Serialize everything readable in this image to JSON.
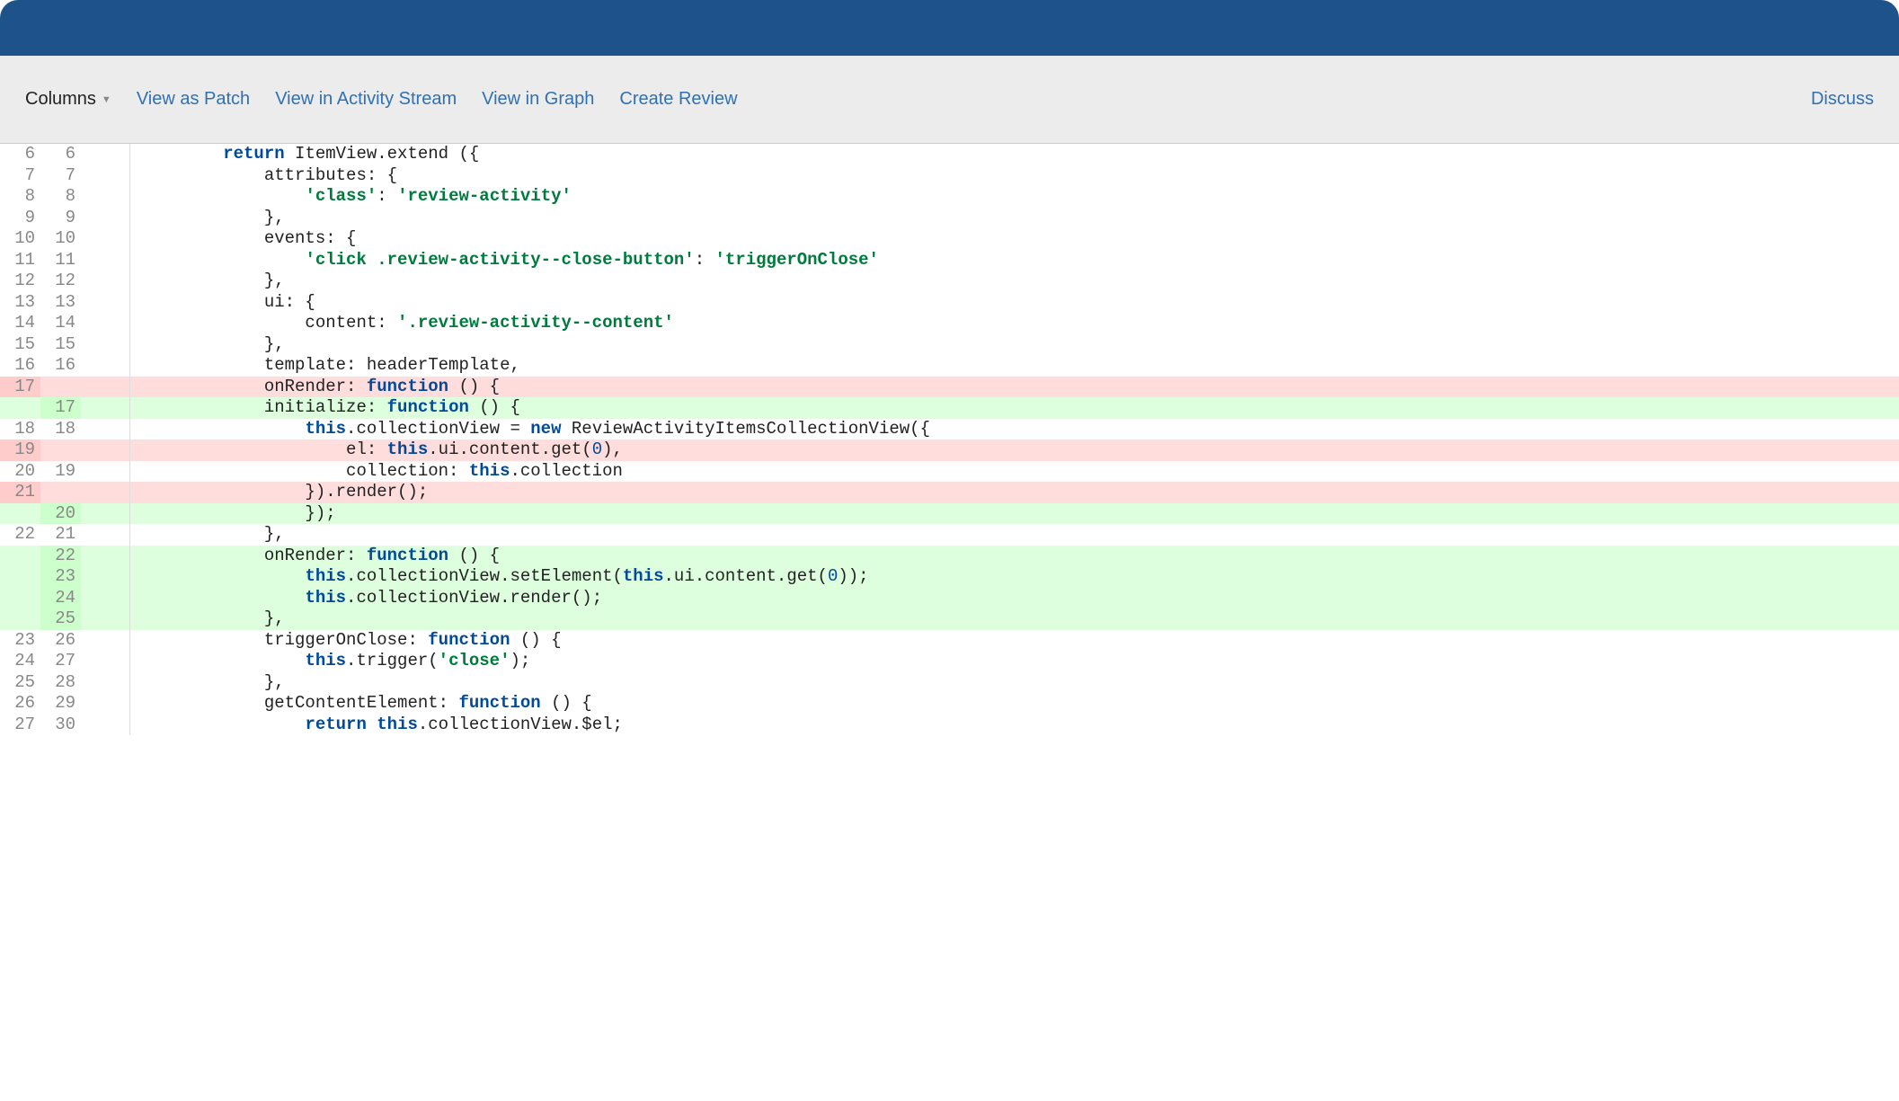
{
  "toolbar": {
    "columns_label": "Columns",
    "links": {
      "view_as_patch": "View as Patch",
      "view_in_activity_stream": "View in Activity Stream",
      "view_in_graph": "View in Graph",
      "create_review": "Create Review"
    },
    "discuss": "Discuss"
  },
  "diff": {
    "rows": [
      {
        "old": "6",
        "new": "6",
        "type": "ctx",
        "tokens": [
          {
            "t": "        "
          },
          {
            "t": "return",
            "c": "tok-kw"
          },
          {
            "t": " ItemView.extend ({"
          }
        ]
      },
      {
        "old": "7",
        "new": "7",
        "type": "ctx",
        "tokens": [
          {
            "t": "            attributes: {"
          }
        ]
      },
      {
        "old": "8",
        "new": "8",
        "type": "ctx",
        "tokens": [
          {
            "t": "                "
          },
          {
            "t": "'class'",
            "c": "tok-str"
          },
          {
            "t": ": "
          },
          {
            "t": "'review-activity'",
            "c": "tok-str"
          }
        ]
      },
      {
        "old": "9",
        "new": "9",
        "type": "ctx",
        "tokens": [
          {
            "t": "            },"
          }
        ]
      },
      {
        "old": "10",
        "new": "10",
        "type": "ctx",
        "tokens": [
          {
            "t": "            events: {"
          }
        ]
      },
      {
        "old": "11",
        "new": "11",
        "type": "ctx",
        "tokens": [
          {
            "t": "                "
          },
          {
            "t": "'click .review-activity--close-button'",
            "c": "tok-str"
          },
          {
            "t": ": "
          },
          {
            "t": "'triggerOnClose'",
            "c": "tok-str"
          }
        ]
      },
      {
        "old": "12",
        "new": "12",
        "type": "ctx",
        "tokens": [
          {
            "t": "            },"
          }
        ]
      },
      {
        "old": "13",
        "new": "13",
        "type": "ctx",
        "tokens": [
          {
            "t": "            ui: {"
          }
        ]
      },
      {
        "old": "14",
        "new": "14",
        "type": "ctx",
        "tokens": [
          {
            "t": "                content: "
          },
          {
            "t": "'.review-activity--content'",
            "c": "tok-str"
          }
        ]
      },
      {
        "old": "15",
        "new": "15",
        "type": "ctx",
        "tokens": [
          {
            "t": "            },"
          }
        ]
      },
      {
        "old": "16",
        "new": "16",
        "type": "ctx",
        "tokens": [
          {
            "t": "            template: headerTemplate,"
          }
        ]
      },
      {
        "old": "17",
        "new": "",
        "type": "del",
        "tokens": [
          {
            "t": "            onRender: "
          },
          {
            "t": "function",
            "c": "tok-kw"
          },
          {
            "t": " () {"
          }
        ]
      },
      {
        "old": "",
        "new": "17",
        "type": "add",
        "tokens": [
          {
            "t": "            initialize: "
          },
          {
            "t": "function",
            "c": "tok-kw"
          },
          {
            "t": " () {"
          }
        ]
      },
      {
        "old": "18",
        "new": "18",
        "type": "ctx",
        "tokens": [
          {
            "t": "                "
          },
          {
            "t": "this",
            "c": "tok-this"
          },
          {
            "t": ".collectionView = "
          },
          {
            "t": "new",
            "c": "tok-kw"
          },
          {
            "t": " ReviewActivityItemsCollectionView({"
          }
        ]
      },
      {
        "old": "19",
        "new": "",
        "type": "del",
        "tokens": [
          {
            "t": "                    el: "
          },
          {
            "t": "this",
            "c": "tok-this"
          },
          {
            "t": ".ui.content.get("
          },
          {
            "t": "0",
            "c": "tok-num"
          },
          {
            "t": "),"
          }
        ]
      },
      {
        "old": "20",
        "new": "19",
        "type": "ctx",
        "tokens": [
          {
            "t": "                    collection: "
          },
          {
            "t": "this",
            "c": "tok-this"
          },
          {
            "t": ".collection"
          }
        ]
      },
      {
        "old": "21",
        "new": "",
        "type": "del",
        "tokens": [
          {
            "t": "                }).render();"
          }
        ]
      },
      {
        "old": "",
        "new": "20",
        "type": "add",
        "tokens": [
          {
            "t": "                });"
          }
        ]
      },
      {
        "old": "22",
        "new": "21",
        "type": "ctx",
        "tokens": [
          {
            "t": "            },"
          }
        ]
      },
      {
        "old": "",
        "new": "22",
        "type": "add",
        "tokens": [
          {
            "t": "            onRender: "
          },
          {
            "t": "function",
            "c": "tok-kw"
          },
          {
            "t": " () {"
          }
        ]
      },
      {
        "old": "",
        "new": "23",
        "type": "add",
        "tokens": [
          {
            "t": "                "
          },
          {
            "t": "this",
            "c": "tok-this"
          },
          {
            "t": ".collectionView.setElement("
          },
          {
            "t": "this",
            "c": "tok-this"
          },
          {
            "t": ".ui.content.get("
          },
          {
            "t": "0",
            "c": "tok-num"
          },
          {
            "t": "));"
          }
        ]
      },
      {
        "old": "",
        "new": "24",
        "type": "add",
        "tokens": [
          {
            "t": "                "
          },
          {
            "t": "this",
            "c": "tok-this"
          },
          {
            "t": ".collectionView.render();"
          }
        ]
      },
      {
        "old": "",
        "new": "25",
        "type": "add",
        "tokens": [
          {
            "t": "            },"
          }
        ]
      },
      {
        "old": "23",
        "new": "26",
        "type": "ctx",
        "tokens": [
          {
            "t": "            triggerOnClose: "
          },
          {
            "t": "function",
            "c": "tok-kw"
          },
          {
            "t": " () {"
          }
        ]
      },
      {
        "old": "24",
        "new": "27",
        "type": "ctx",
        "tokens": [
          {
            "t": "                "
          },
          {
            "t": "this",
            "c": "tok-this"
          },
          {
            "t": ".trigger("
          },
          {
            "t": "'close'",
            "c": "tok-str"
          },
          {
            "t": ");"
          }
        ]
      },
      {
        "old": "25",
        "new": "28",
        "type": "ctx",
        "tokens": [
          {
            "t": "            },"
          }
        ]
      },
      {
        "old": "26",
        "new": "29",
        "type": "ctx",
        "tokens": [
          {
            "t": "            getContentElement: "
          },
          {
            "t": "function",
            "c": "tok-kw"
          },
          {
            "t": " () {"
          }
        ]
      },
      {
        "old": "27",
        "new": "30",
        "type": "ctx",
        "tokens": [
          {
            "t": "                "
          },
          {
            "t": "return",
            "c": "tok-kw"
          },
          {
            "t": " "
          },
          {
            "t": "this",
            "c": "tok-this"
          },
          {
            "t": ".collectionView.$el;"
          }
        ]
      }
    ]
  }
}
